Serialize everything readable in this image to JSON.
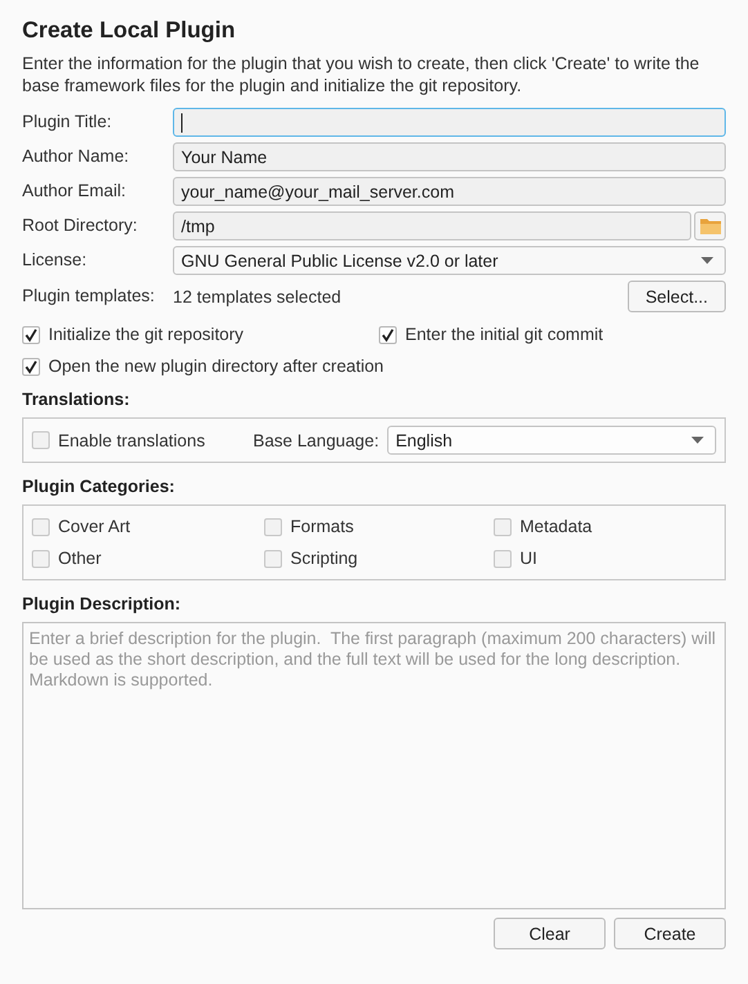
{
  "dialog": {
    "title": "Create Local Plugin",
    "intro": "Enter the information for the plugin that you wish to create, then click 'Create' to write the base framework files for the plugin and initialize the git repository."
  },
  "fields": [
    {
      "kind": "text",
      "label": "Plugin Title:",
      "focused": true
    },
    {
      "kind": "text",
      "label": "Author Name:",
      "value": "Your Name",
      "focused": false
    },
    {
      "kind": "text",
      "label": "Author Email:",
      "value": "your_name@your_mail_server.com",
      "focused": false
    },
    {
      "kind": "directory",
      "label": "Root Directory:",
      "value": "/tmp",
      "focused": false
    },
    {
      "kind": "select",
      "label": "License:",
      "value": "GNU General Public License v2.0 or later",
      "focused": false
    }
  ],
  "templates": {
    "label": "Plugin templates:",
    "value": "12 templates selected",
    "button": "Select..."
  },
  "options": [
    {
      "label": "Initialize the git repository",
      "checked": true
    },
    {
      "label": "Enter the initial git commit",
      "checked": true
    },
    {
      "label": "Open the new plugin directory after creation",
      "checked": true
    }
  ],
  "translations": {
    "heading": "Translations:",
    "enable": {
      "label": "Enable translations",
      "checked": false
    },
    "base_language": {
      "label": "Base Language:",
      "value": "English"
    }
  },
  "categories": {
    "heading": "Plugin Categories:",
    "items": [
      {
        "label": "Cover Art",
        "checked": false
      },
      {
        "label": "Formats",
        "checked": false
      },
      {
        "label": "Metadata",
        "checked": false
      },
      {
        "label": "Other",
        "checked": false
      },
      {
        "label": "Scripting",
        "checked": false
      },
      {
        "label": "UI",
        "checked": false
      }
    ]
  },
  "description": {
    "heading": "Plugin Description:",
    "placeholder": "Enter a brief description for the plugin.  The first paragraph (maximum 200 characters) will be used as the short description, and the full text will be used for the long description. Markdown is supported."
  },
  "buttons": [
    "Clear",
    "Create"
  ]
}
